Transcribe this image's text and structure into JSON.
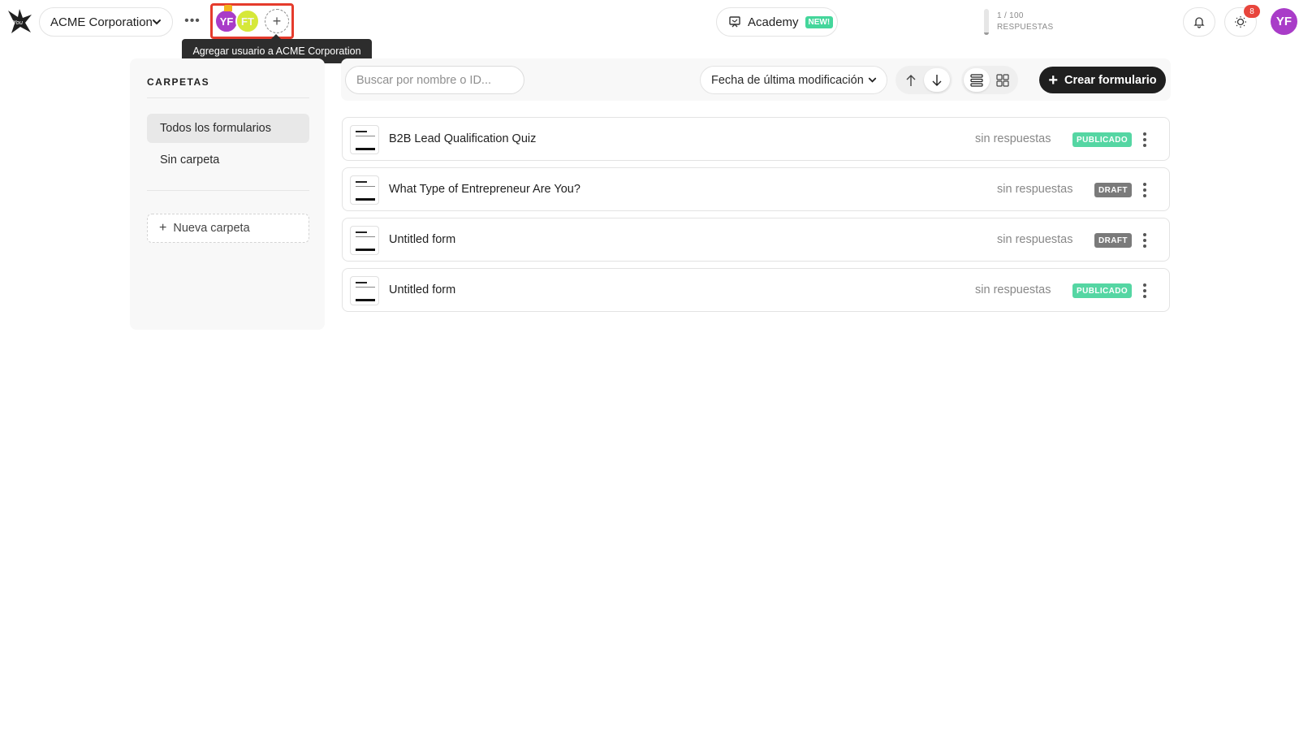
{
  "topbar": {
    "workspace_name": "ACME Corporation",
    "more_label": "•••",
    "members": [
      {
        "initials": "YF",
        "color": "#a93cc8"
      },
      {
        "initials": "FT",
        "color": "#d6e83a"
      }
    ],
    "add_member_label": "+",
    "tooltip": "Agregar usuario a ACME Corporation",
    "academy_label": "Academy",
    "academy_badge": "NEW!",
    "quota_count": "1 / 100",
    "quota_label": "RESPUESTAS",
    "quota_fraction": 0.01,
    "notification_count": "8",
    "user_initials": "YF"
  },
  "sidebar": {
    "title": "CARPETAS",
    "items": [
      {
        "label": "Todos los formularios",
        "active": true
      },
      {
        "label": "Sin carpeta",
        "active": false
      }
    ],
    "new_folder_label": "Nueva carpeta"
  },
  "toolbar": {
    "search_placeholder": "Buscar por nombre o ID...",
    "sort_label": "Fecha de última modificación",
    "create_label": "Crear formulario"
  },
  "forms": [
    {
      "name": "B2B Lead Qualification Quiz",
      "responses": "sin respuestas",
      "status": "PUBLICADO",
      "status_type": "published"
    },
    {
      "name": "What Type of Entrepreneur Are You?",
      "responses": "sin respuestas",
      "status": "DRAFT",
      "status_type": "draft"
    },
    {
      "name": "Untitled form",
      "responses": "sin respuestas",
      "status": "DRAFT",
      "status_type": "draft"
    },
    {
      "name": "Untitled form",
      "responses": "sin respuestas",
      "status": "PUBLICADO",
      "status_type": "published"
    }
  ],
  "colors": {
    "accent_dark": "#1f1f1f",
    "published": "#55d6a3",
    "draft": "#7a7a7a",
    "highlight": "#e53b2c",
    "avatar_purple": "#a93cc8",
    "notification": "#e8453c"
  }
}
